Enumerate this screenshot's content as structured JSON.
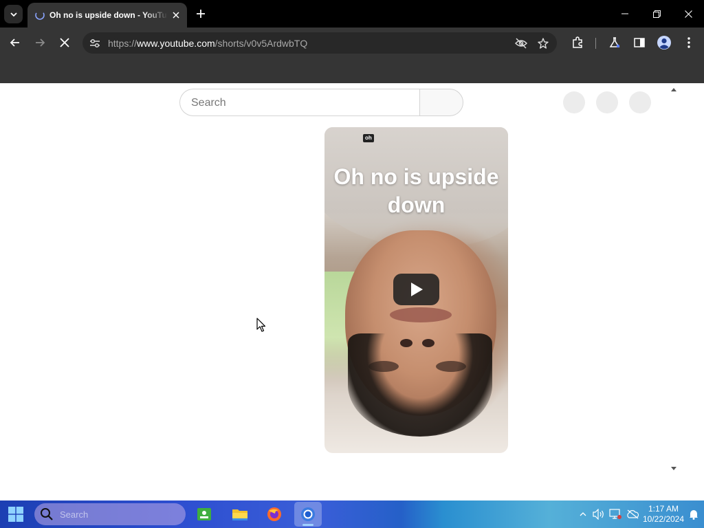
{
  "browser": {
    "tab": {
      "title": "Oh no is upside down - YouTube"
    },
    "address_bar": {
      "url_prefix": "https://",
      "url_host": "www.youtube.com",
      "url_path": "/shorts/v0v5ArdwbTQ"
    }
  },
  "youtube": {
    "search": {
      "placeholder": "Search"
    },
    "short": {
      "chip_text": "oh",
      "caption": "Oh no is upside down"
    }
  },
  "taskbar": {
    "search_placeholder": "Search",
    "clock": {
      "time": "1:17 AM",
      "date": "10/22/2024"
    }
  },
  "colors": {
    "browser_dark": "#353535",
    "youtube_bg": "#ffffff",
    "taskbar_blue": "#2d4ed0"
  },
  "icons": [
    "chevron-down-icon",
    "youtube-favicon",
    "close-icon",
    "plus-icon",
    "minimize-icon",
    "restore-icon",
    "back-arrow-icon",
    "forward-arrow-icon",
    "stop-loading-icon",
    "site-settings-icon",
    "eye-off-icon",
    "star-icon",
    "extensions-icon",
    "labs-flask-icon",
    "side-panel-icon",
    "profile-icon",
    "kebab-menu-icon",
    "play-icon",
    "windows-start-icon",
    "search-icon",
    "green-app-icon",
    "file-explorer-icon",
    "firefox-icon",
    "chrome-icon",
    "chevron-up-icon",
    "speaker-icon",
    "network-icon",
    "onedrive-icon",
    "bell-icon"
  ]
}
